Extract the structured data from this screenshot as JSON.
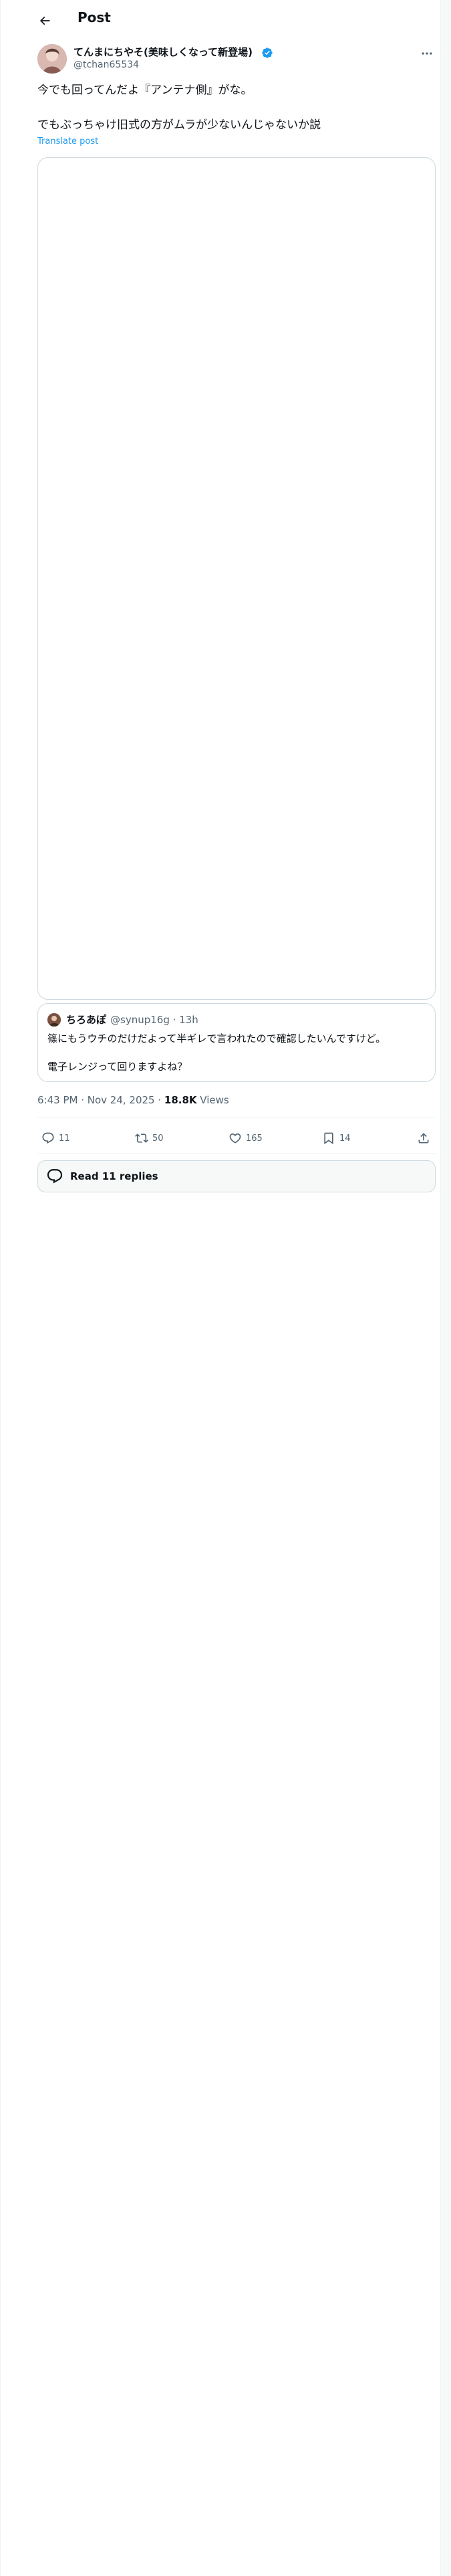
{
  "header": {
    "title": "Post"
  },
  "author": {
    "display_name": "てんまにちやそ(美味しくなって新登場)",
    "handle": "@tchan65534",
    "verified": true
  },
  "tweet": {
    "line1": "今でも回ってんだよ『アンテナ側』がな。",
    "line2": "でもぶっちゃけ旧式の方がムラが少ないんじゃないか説",
    "translate_label": "Translate post"
  },
  "quote": {
    "display_name": "ちろあぽ",
    "handle_time": "@synup16g · 13h",
    "text1": "篠にもうウチのだけだよって半ギレで言われたので確認したいんですけど。",
    "text2": "電子レンジって回りますよね？"
  },
  "meta": {
    "time_date": "6:43 PM · Nov 24, 2025 · ",
    "views_count": "18.8K",
    "views_label": " Views"
  },
  "actions": {
    "replies": "11",
    "reposts": "50",
    "likes": "165",
    "bookmarks": "14"
  },
  "read_replies": {
    "label": "Read 11 replies"
  },
  "colors": {
    "accent": "#1d9bf0",
    "text_primary": "#0f1419",
    "text_secondary": "#536471",
    "border": "#cfd9de"
  }
}
